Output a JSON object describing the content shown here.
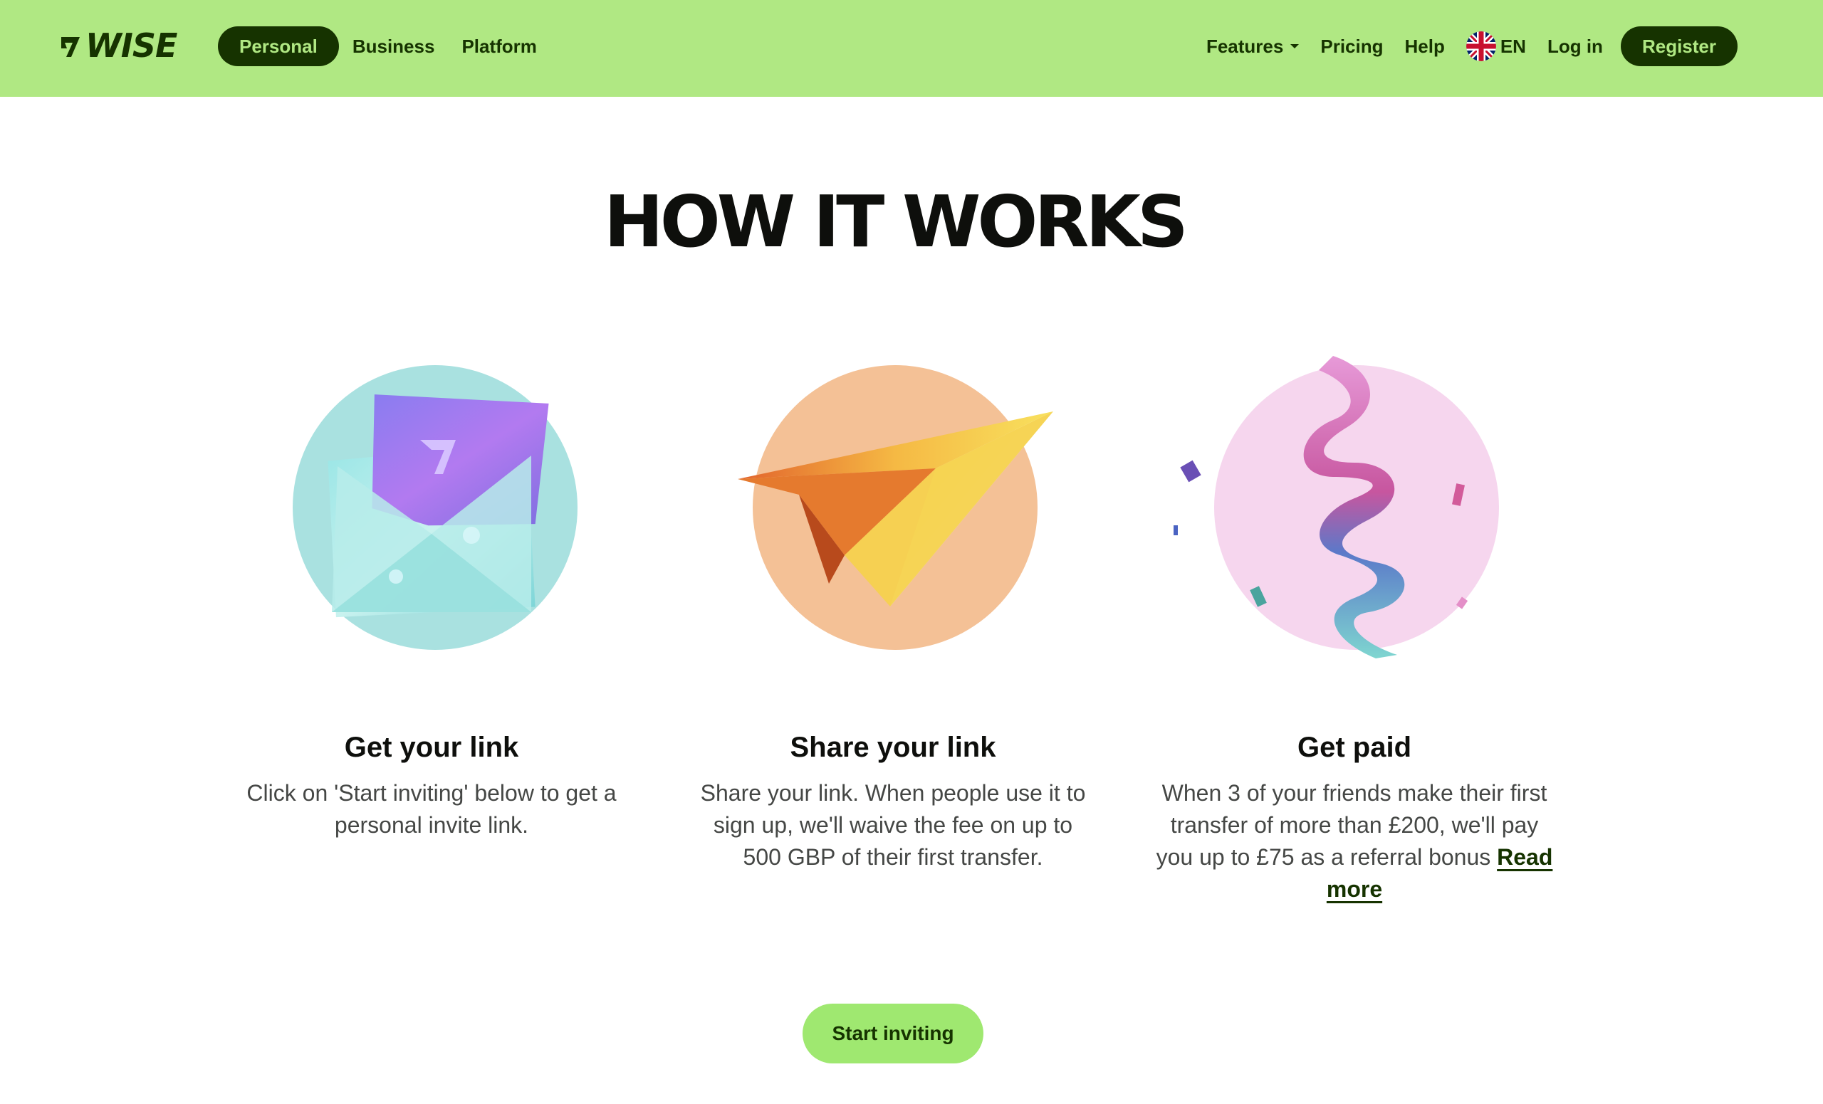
{
  "header": {
    "logo_text": "WISE",
    "segments": [
      {
        "label": "Personal",
        "active": true
      },
      {
        "label": "Business",
        "active": false
      },
      {
        "label": "Platform",
        "active": false
      }
    ],
    "right_nav": {
      "features": "Features",
      "pricing": "Pricing",
      "help": "Help",
      "language": "EN",
      "login": "Log in",
      "register": "Register"
    }
  },
  "main": {
    "heading": "HOW IT WORKS",
    "steps": [
      {
        "title": "Get your link",
        "text": "Click on 'Start inviting' below to get a personal invite link.",
        "icon": "envelope-illustration"
      },
      {
        "title": "Share your link",
        "text": "Share your link. When people use it to sign up, we'll waive the fee on up to 500 GBP of their first transfer.",
        "icon": "paper-plane-illustration"
      },
      {
        "title": "Get paid",
        "text": "When 3 of your friends make their first transfer of more than £200, we'll pay you up to £75 as a referral bonus",
        "link": "Read more",
        "icon": "ribbon-confetti-illustration"
      }
    ],
    "cta": "Start inviting"
  },
  "colors": {
    "brand_green": "#b0e883",
    "forest_green": "#163300",
    "cta_green": "#9fe870",
    "teal_circle": "#a9e1e0",
    "orange_circle": "#f4c196",
    "pink_circle": "#f6d6ee"
  }
}
